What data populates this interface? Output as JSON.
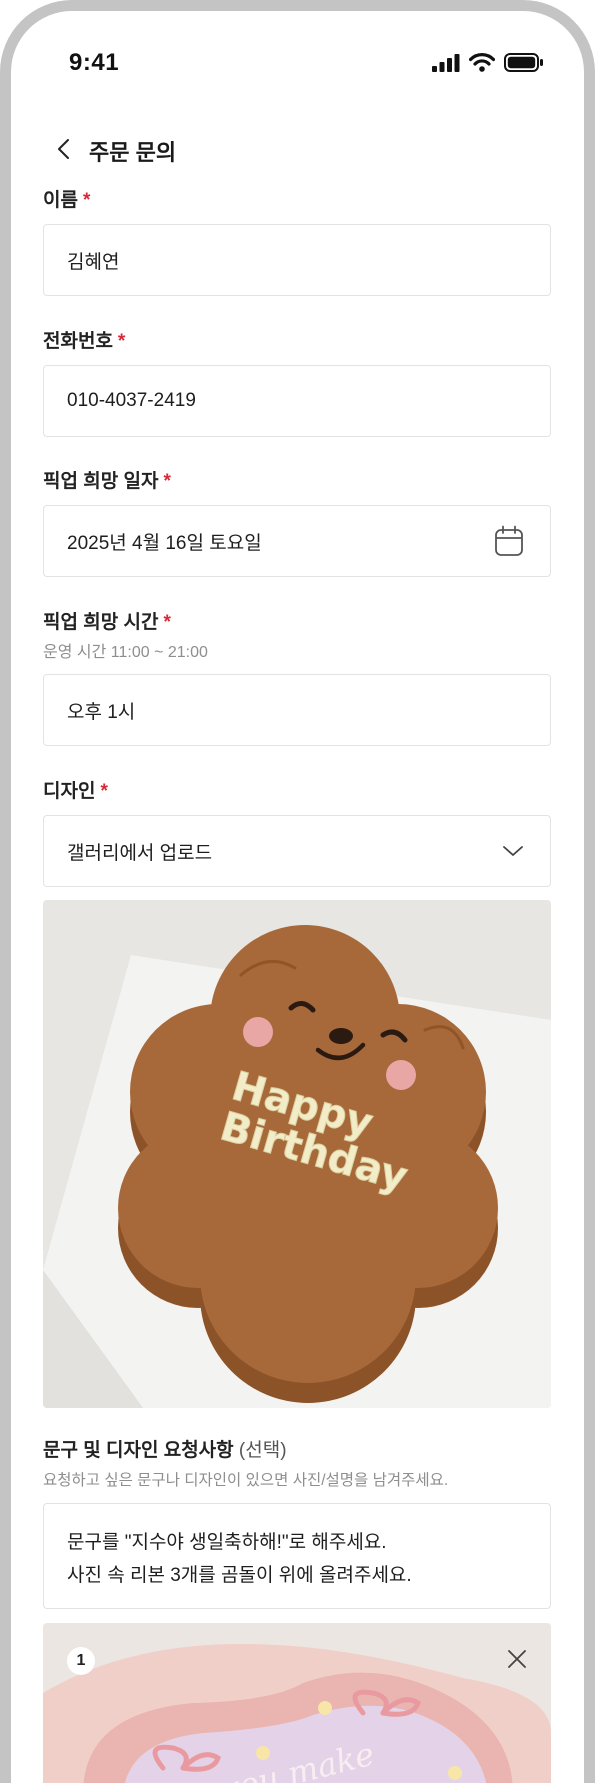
{
  "status_bar": {
    "time": "9:41"
  },
  "header": {
    "title": "주문 문의"
  },
  "required_mark": "*",
  "form": {
    "name": {
      "label": "이름",
      "value": "김혜연"
    },
    "phone": {
      "label": "전화번호",
      "value": "010-4037-2419"
    },
    "pickup_date": {
      "label": "픽업 희망 일자",
      "value": "2025년 4월 16일 토요일"
    },
    "pickup_time": {
      "label": "픽업 희망 시간",
      "helper": "운영 시간 11:00 ~ 21:00",
      "value": "오후 1시"
    },
    "design": {
      "label": "디자인",
      "selected": "갤러리에서 업로드",
      "cake_text_line1": "Happy",
      "cake_text_line2": "Birthday"
    },
    "request": {
      "label": "문구 및 디자인 요청사항",
      "optional": "(선택)",
      "helper": "요청하고 싶은 문구나 디자인이 있으면 사진/설명을 남겨주세요.",
      "lines": [
        "문구를 \"지수야 생일축하해!\"로 해주세요.",
        "사진 속 리본 3개를 곰돌이 위에 올려주세요."
      ],
      "attachment_index": "1",
      "attachment_text": "you make"
    }
  },
  "icons": {
    "back": "chevron-left-icon",
    "calendar": "calendar-icon",
    "dropdown": "chevron-down-icon",
    "close": "close-icon"
  },
  "colors": {
    "required": "#d8293a",
    "border": "#e3e3e3",
    "cake": "#a7683a",
    "frame": "#c4c4c4"
  }
}
